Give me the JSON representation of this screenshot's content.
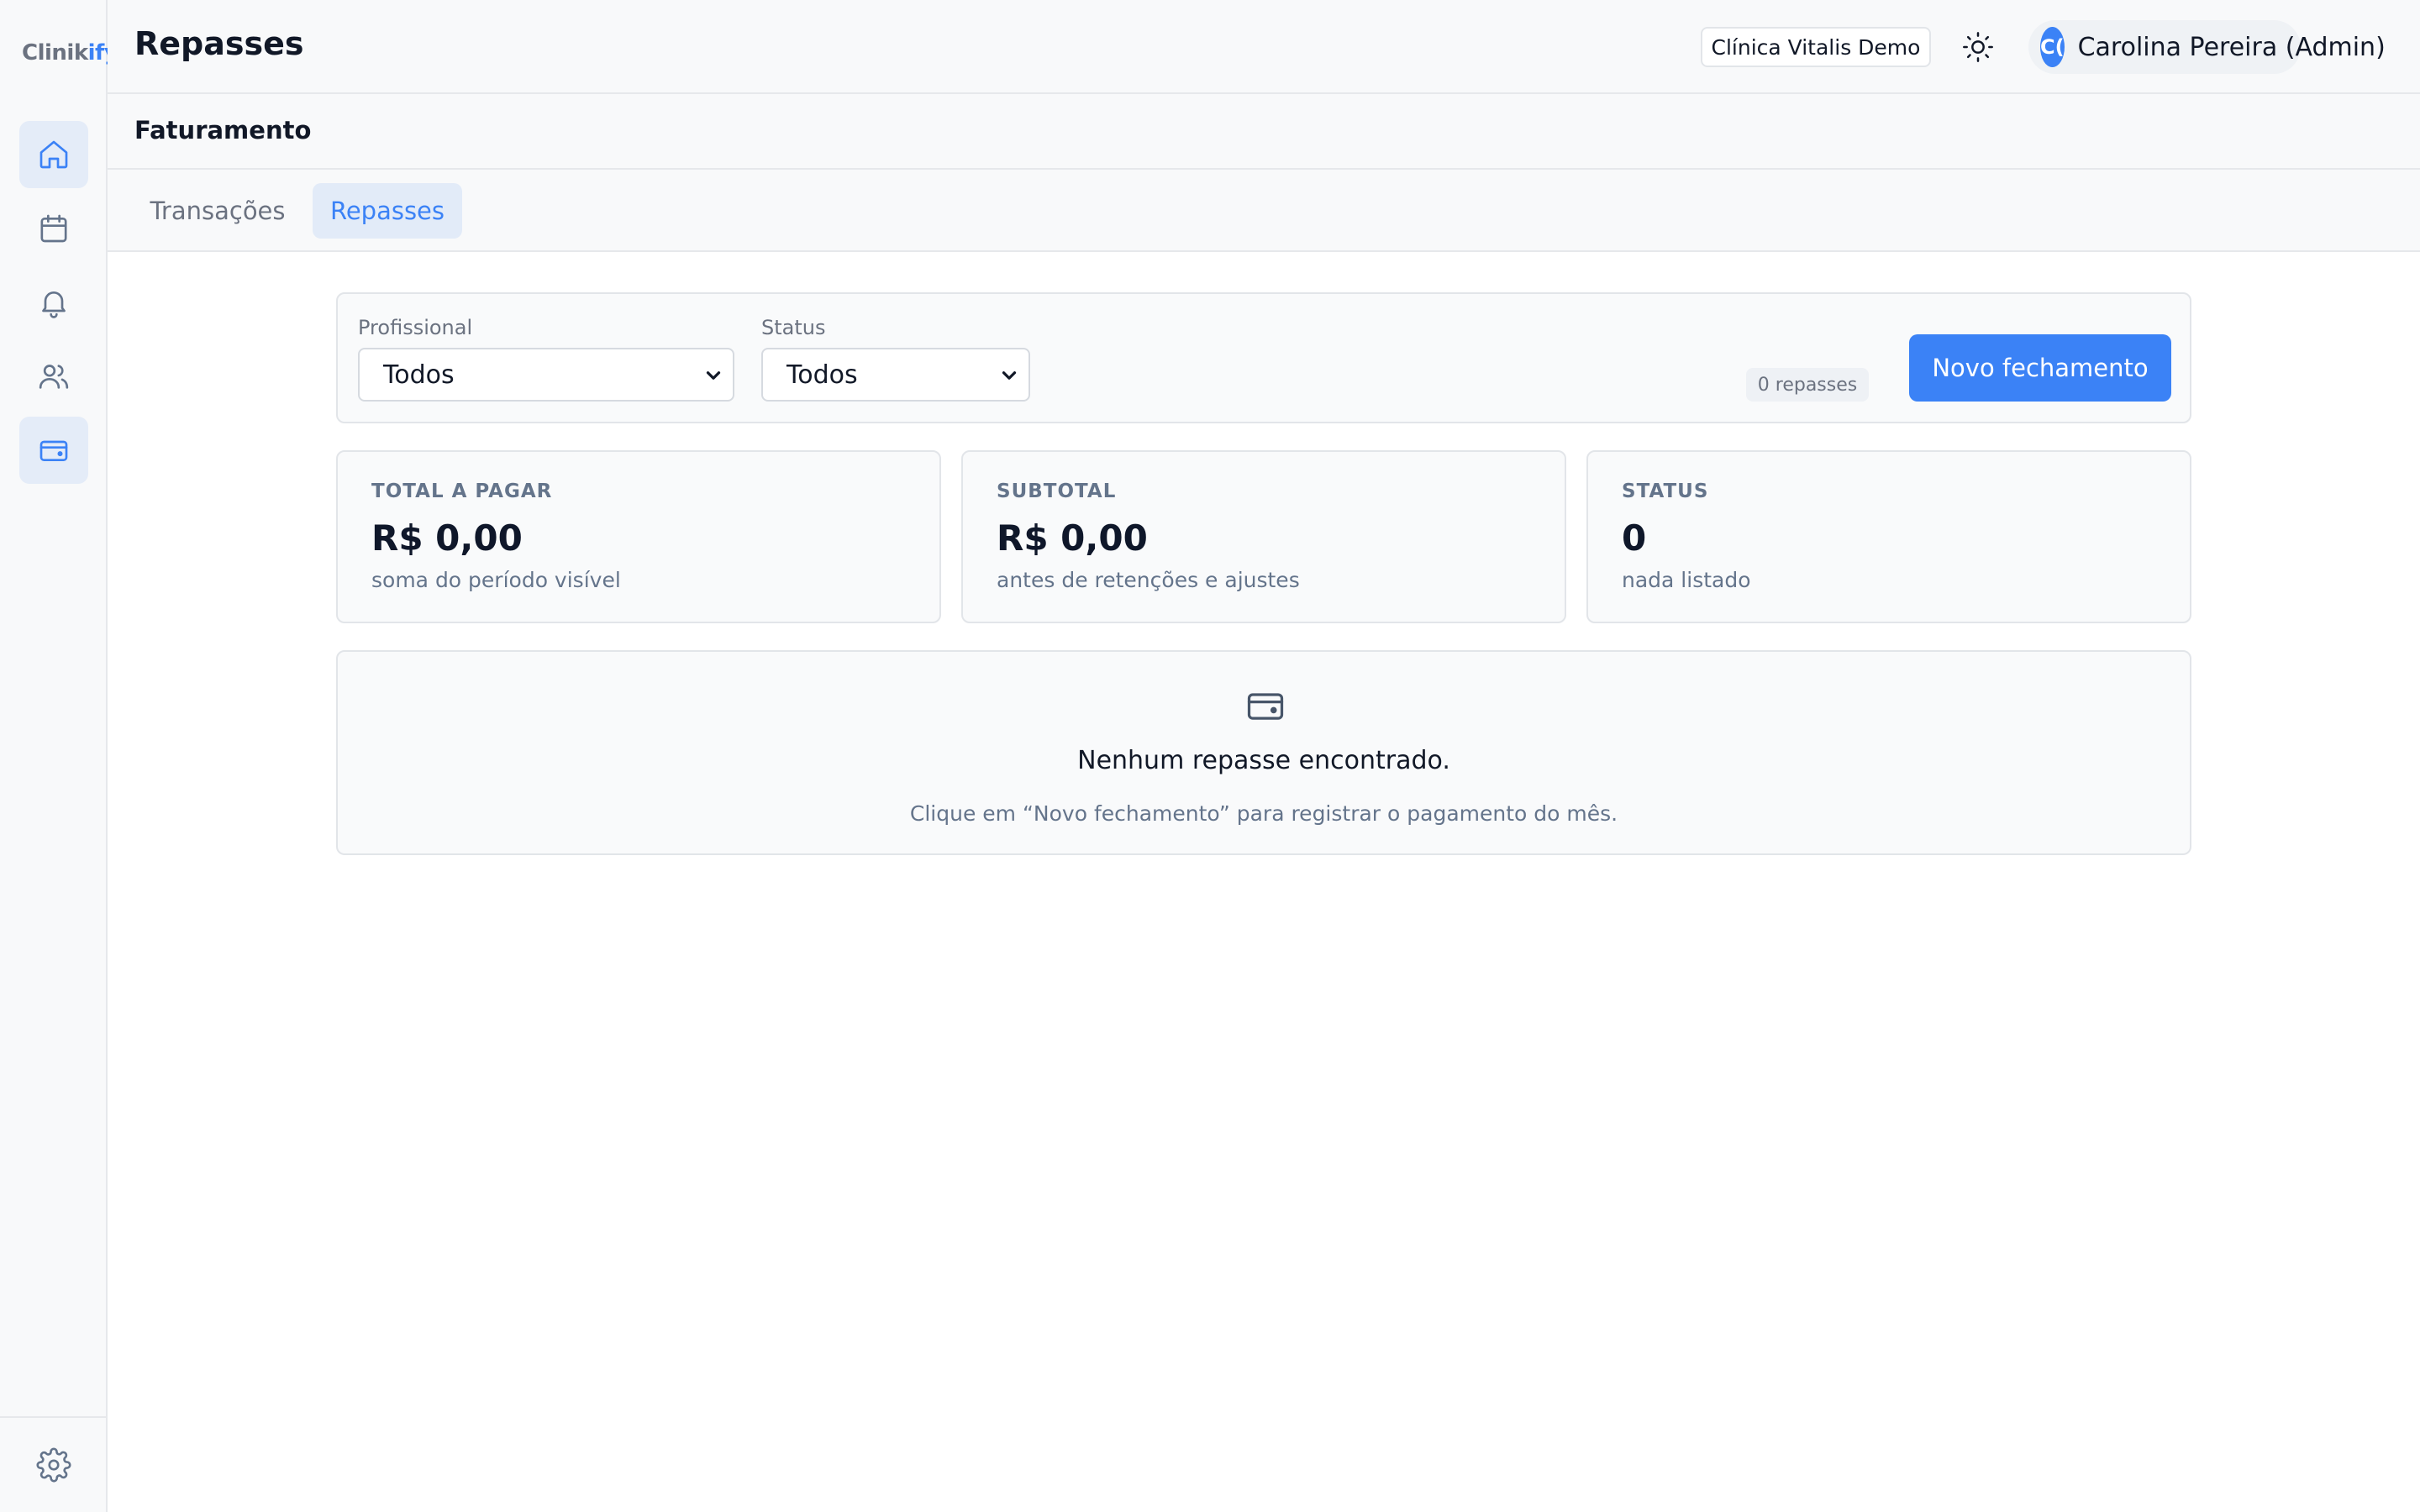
{
  "app": {
    "logo_main": "Clinik",
    "logo_accent": "ify"
  },
  "sidebar": {
    "items": [
      {
        "name": "home",
        "icon": "home-icon",
        "active": true
      },
      {
        "name": "calendar",
        "icon": "calendar-icon",
        "active": false
      },
      {
        "name": "notifications",
        "icon": "bell-icon",
        "active": false
      },
      {
        "name": "patients",
        "icon": "users-icon",
        "active": false
      },
      {
        "name": "billing",
        "icon": "wallet-icon",
        "active": true
      }
    ],
    "settings_icon": "gear-icon"
  },
  "header": {
    "title": "Repasses",
    "clinic": "Clínica Vitalis Demo",
    "theme_icon": "sun-icon",
    "user": {
      "initials": "C(",
      "name": "Carolina Pereira (Admin)"
    }
  },
  "section": {
    "title": "Faturamento"
  },
  "tabs": [
    {
      "label": "Transações",
      "active": false
    },
    {
      "label": "Repasses",
      "active": true
    }
  ],
  "filters": {
    "professional": {
      "label": "Profissional",
      "value": "Todos"
    },
    "status": {
      "label": "Status",
      "value": "Todos"
    },
    "count": "0 repasses",
    "new_button": "Novo fechamento"
  },
  "stats": [
    {
      "label": "TOTAL A PAGAR",
      "value": "R$ 0,00",
      "sub": "soma do período visível"
    },
    {
      "label": "SUBTOTAL",
      "value": "R$ 0,00",
      "sub": "antes de retenções e ajustes"
    },
    {
      "label": "STATUS",
      "value": "0",
      "sub": "nada listado"
    }
  ],
  "empty": {
    "icon": "wallet-icon",
    "title": "Nenhum repasse encontrado.",
    "hint": "Clique em “Novo fechamento” para registrar o pagamento do mês."
  },
  "colors": {
    "accent": "#3b82f6",
    "sidebar_active": "#e4ecf8",
    "muted": "#64748b"
  }
}
